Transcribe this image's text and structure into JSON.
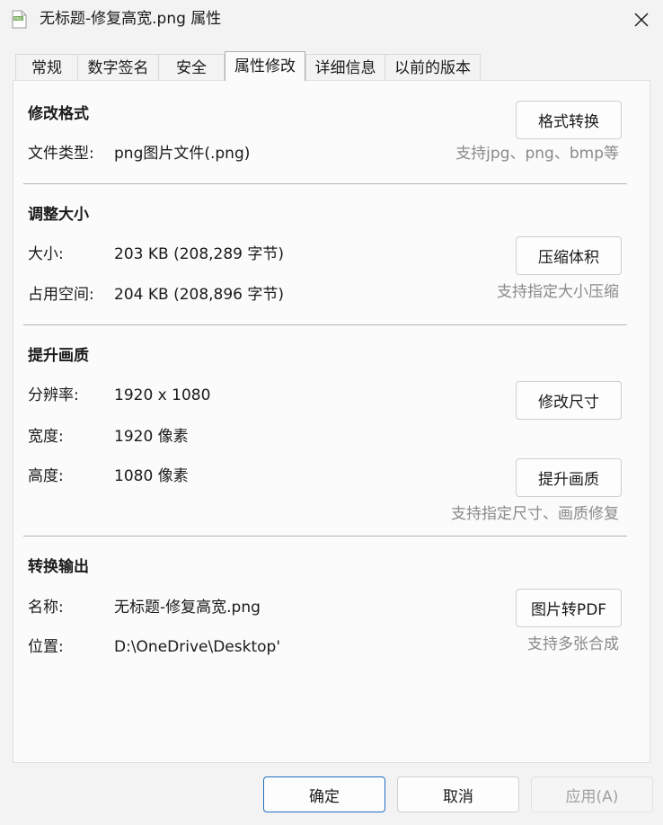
{
  "window": {
    "title": "无标题-修复高宽.png 属性",
    "file_icon_text": "PNG"
  },
  "tabs": [
    {
      "label": "常规"
    },
    {
      "label": "数字签名"
    },
    {
      "label": "安全"
    },
    {
      "label": "属性修改",
      "active": true
    },
    {
      "label": "详细信息"
    },
    {
      "label": "以前的版本"
    }
  ],
  "format": {
    "heading": "修改格式",
    "button": "格式转换",
    "type_label": "文件类型:",
    "type_value": "png图片文件(.png)",
    "hint": "支持jpg、png、bmp等"
  },
  "size": {
    "heading": "调整大小",
    "size_label": "大小:",
    "size_value": "203 KB (208,289 字节)",
    "disk_label": "占用空间:",
    "disk_value": "204 KB (208,896 字节)",
    "button": "压缩体积",
    "hint": "支持指定大小压缩"
  },
  "quality": {
    "heading": "提升画质",
    "resolution_label": "分辨率:",
    "resolution_value": "1920 x 1080",
    "width_label": "宽度:",
    "width_value": "1920 像素",
    "height_label": "高度:",
    "height_value": "1080 像素",
    "resize_button": "修改尺寸",
    "enhance_button": "提升画质",
    "hint": "支持指定尺寸、画质修复"
  },
  "output": {
    "heading": "转换输出",
    "name_label": "名称:",
    "name_value": "无标题-修复高宽.png",
    "location_label": "位置:",
    "location_value": "D:\\OneDrive\\Desktop'",
    "button": "图片转PDF",
    "hint": "支持多张合成"
  },
  "footer": {
    "ok": "确定",
    "cancel": "取消",
    "apply": "应用(A)"
  },
  "colors": {
    "window_bg": "#f3f3f3",
    "panel_bg": "#fbfbfb",
    "hint_text": "#8a8a8a",
    "primary_border": "#1f6fbd"
  }
}
